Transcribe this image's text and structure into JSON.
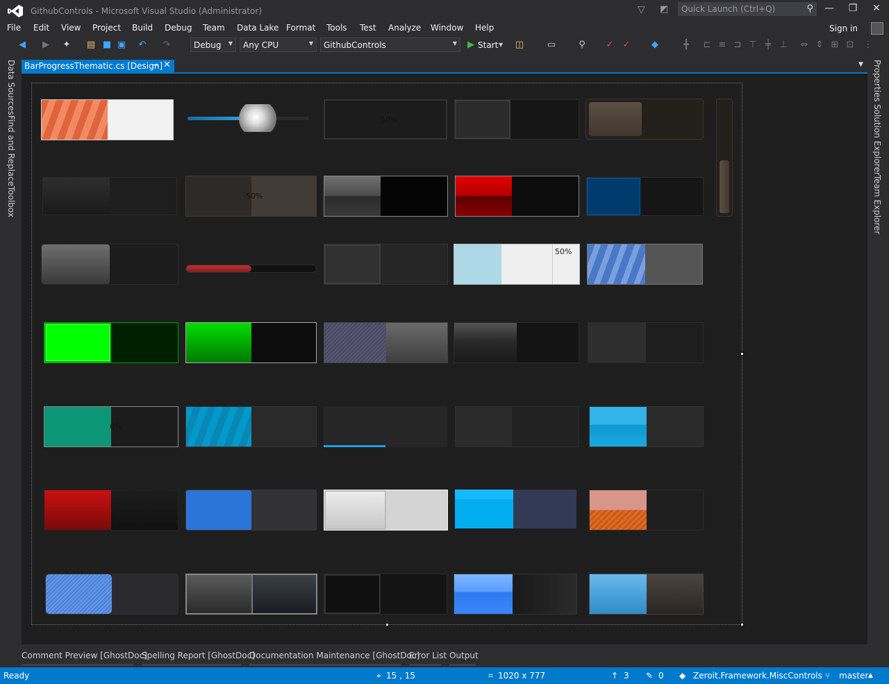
{
  "titlebar": {
    "title": "GithubControls - Microsoft Visual Studio  (Administrator)",
    "quick_launch_placeholder": "Quick Launch (Ctrl+Q)"
  },
  "menu": {
    "items": [
      "File",
      "Edit",
      "View",
      "Project",
      "Build",
      "Debug",
      "Team",
      "Data Lake",
      "Format",
      "Tools",
      "Test",
      "Analyze",
      "Window",
      "Help"
    ],
    "sign_in": "Sign in"
  },
  "toolbar": {
    "config": "Debug",
    "platform": "Any CPU",
    "project": "GithubControls",
    "start_label": "Start"
  },
  "side_tabs": {
    "left": [
      "Data Sources",
      "Find and Replace",
      "Toolbox"
    ],
    "right": [
      "Properties",
      "Solution Explorer",
      "Team Explorer"
    ]
  },
  "document_tab": {
    "label": "BarProgressThematic.cs [Design]"
  },
  "progress_labels": {
    "dark_50": "50%",
    "brown_50": "50%",
    "light_50": "50%",
    "teal_0": "0%"
  },
  "progress_values": {
    "row1": [
      0.5,
      0.5,
      0.5,
      0.45,
      0.45
    ],
    "row2": [
      0.5,
      0.5,
      0.46,
      0.46,
      0.46
    ],
    "row3": [
      0.5,
      0.5,
      0.46,
      0.38,
      0.5
    ],
    "row4": [
      0.5,
      0.5,
      0.5,
      0.5,
      0.5
    ],
    "row5": [
      0.5,
      0.5,
      0.5,
      0.46,
      0.5
    ],
    "row6": [
      0.5,
      0.5,
      0.5,
      0.48,
      0.5
    ],
    "row7": [
      0.5,
      0.5,
      0.46,
      0.48,
      0.5
    ],
    "vertical": 0.5
  },
  "bottom_tabs": [
    "Comment Preview [GhostDoc]",
    "Spelling Report [GhostDoc]",
    "Documentation Maintenance [GhostDoc]",
    "Error List",
    "Output"
  ],
  "status": {
    "ready": "Ready",
    "position": "15 , 15",
    "size": "1020 x 777",
    "up_count": "3",
    "edit_count": "0",
    "repo": "Zeroit.Framework.MiscControls",
    "branch": "master"
  },
  "colors": {
    "accent": "#007acc",
    "surface": "#1e1e1e",
    "chrome": "#2d2d30"
  }
}
